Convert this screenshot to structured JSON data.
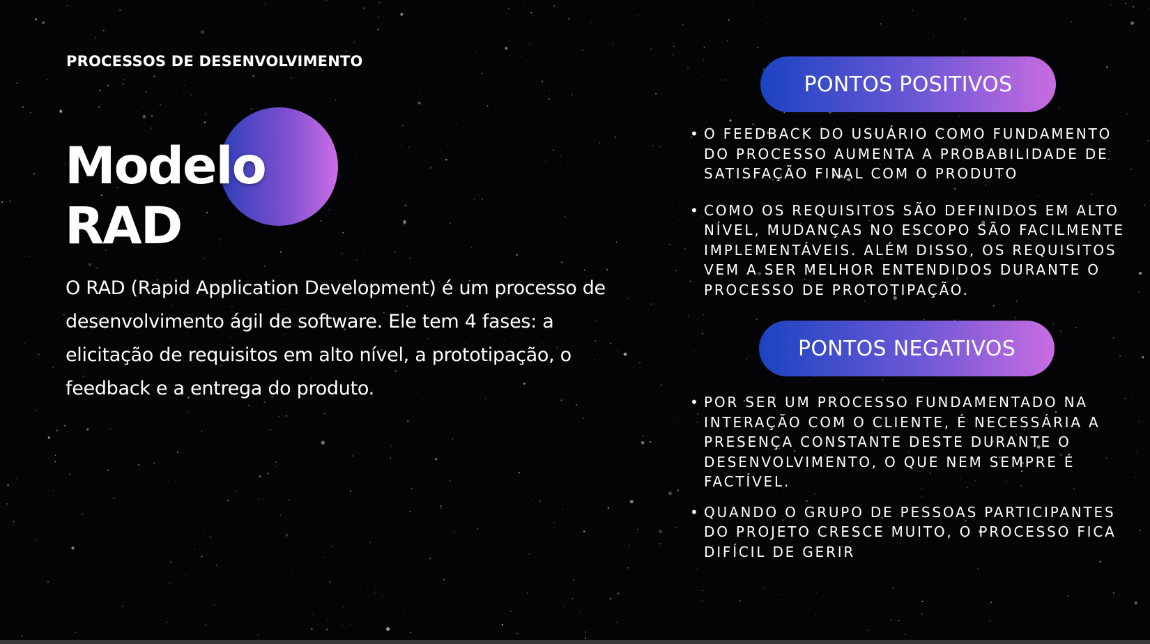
{
  "slide": {
    "section_label": "PROCESSOS DE DESENVOLVIMENTO",
    "title_line1": "Modelo",
    "title_line2": "RAD",
    "description": "O RAD (Rapid Application Development) é um processo de desenvolvimento ágil de software. Ele tem 4 fases: a elicitação de requisitos em alto nível, a prototipação, o feedback e a entrega do produto."
  },
  "positives": {
    "heading": "PONTOS POSITIVOS",
    "items": [
      "O FEEDBACK DO USUÁRIO COMO FUNDAMENTO DO PROCESSO AUMENTA A PROBABILIDADE DE SATISFAÇÃO FINAL COM O PRODUTO",
      "COMO OS REQUISITOS SÃO DEFINIDOS EM ALTO NÍVEL, MUDANÇAS NO ESCOPO SÃO FACILMENTE IMPLEMENTÁVEIS. ALÉM DISSO, OS REQUISITOS VEM A SER MELHOR ENTENDIDOS DURANTE O PROCESSO DE PROTOTIPAÇÃO."
    ]
  },
  "negatives": {
    "heading": "PONTOS NEGATIVOS",
    "items": [
      "POR SER UM PROCESSO FUNDAMENTADO NA INTERAÇÃO COM O CLIENTE, É NECESSÁRIA A PRESENÇA CONSTANTE DESTE DURANTE O DESENVOLVIMENTO, O QUE NEM SEMPRE É FACTÍVEL.",
      "QUANDO O GRUPO DE PESSOAS PARTICIPANTES DO PROJETO CRESCE MUITO, O PROCESSO FICA DIFÍCIL DE GERIR"
    ]
  },
  "colors": {
    "background": "#050507",
    "gradient_start": "#1b44c1",
    "gradient_end": "#c86ce0",
    "text": "#ffffff"
  }
}
